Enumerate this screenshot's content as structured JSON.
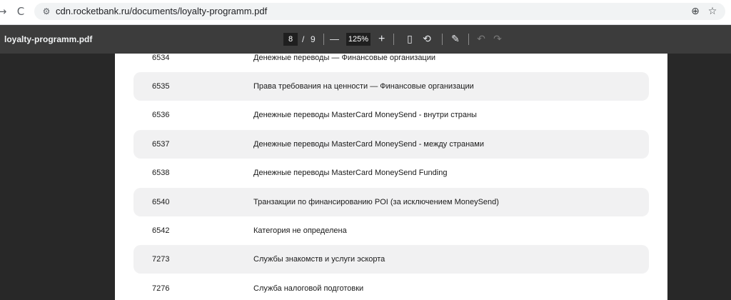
{
  "browser": {
    "url": "cdn.rocketbank.ru/documents/loyalty-programm.pdf",
    "icons": {
      "forward": "→",
      "reload": "C",
      "site_info": "⚙",
      "zoom": "⊕",
      "bookmark": "☆"
    }
  },
  "pdf_toolbar": {
    "title": "loyalty-programm.pdf",
    "current_page": "8",
    "separator": "/",
    "total_pages": "9",
    "zoom_out": "—",
    "zoom_level": "125%",
    "zoom_in": "+",
    "icons": {
      "fit_page": "▯",
      "rotate": "⟲",
      "annotate": "✎",
      "undo": "↶",
      "redo": "↷"
    }
  },
  "document": {
    "rows": [
      {
        "code": "6534",
        "description": "Денежные переводы — Финансовые организации"
      },
      {
        "code": "6535",
        "description": "Права требования на ценности — Финансовые организации"
      },
      {
        "code": "6536",
        "description": "Денежные переводы MasterCard MoneySend - внутри страны"
      },
      {
        "code": "6537",
        "description": "Денежные переводы MasterCard MoneySend - между странами"
      },
      {
        "code": "6538",
        "description": "Денежные переводы MasterCard MoneySend Funding"
      },
      {
        "code": "6540",
        "description": "Транзакции по финансированию POI (за исключением MoneySend)"
      },
      {
        "code": "6542",
        "description": "Категория не определена"
      },
      {
        "code": "7273",
        "description": "Службы знакомств и услуги эскорта"
      },
      {
        "code": "7276",
        "description": "Служба налоговой подготовки"
      }
    ]
  }
}
